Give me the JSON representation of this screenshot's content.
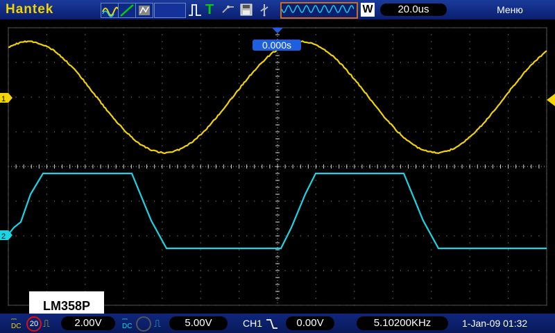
{
  "topbar": {
    "brand": "Hantek",
    "timebase": "20.0us",
    "w_label": "W",
    "menu_label": "Меню",
    "t_label": "T"
  },
  "screen": {
    "trigger_time": "0.000s",
    "annotation": "LM358P",
    "ch1_marker": "1",
    "ch2_marker": "2"
  },
  "bottombar": {
    "ch1_coupling": "DC",
    "ch1_bw": "20",
    "ch1_volts": "2.00V",
    "ch2_coupling": "DC",
    "ch2_volts": "5.00V",
    "trigger_source": "CH1",
    "trigger_level": "0.00V",
    "frequency": "5.10200KHz",
    "datetime": "1-Jan-09 01:32"
  },
  "colors": {
    "ch1": "#f2d400",
    "ch2": "#18d6e6",
    "accent": "#1d5fe0"
  }
}
